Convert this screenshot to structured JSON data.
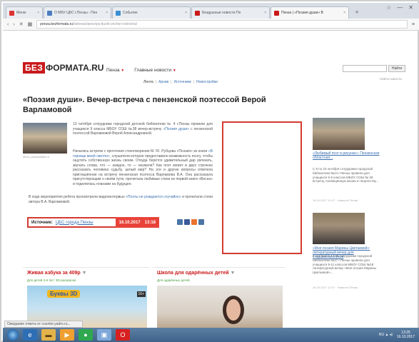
{
  "browser": {
    "tabs": [
      {
        "label": "Меню",
        "color": "#d33"
      },
      {
        "label": "О МБУ ЦБС г.Пензы - Пен",
        "color": "#4d7dbf"
      },
      {
        "label": "Событие",
        "color": "#3a8fd0"
      },
      {
        "label": "Бездушные новости Пе",
        "color": "#c9191b"
      },
      {
        "label": "Пенза | «Поэзия души» В",
        "color": "#c9191b",
        "active": true
      }
    ],
    "new_tab": "+",
    "url_host": "penza.bezformata.ru",
    "url_rest": "/listnews/poeziya-dushi-vecher-vstrecha/",
    "window_controls": [
      "☆",
      "—",
      "✕"
    ]
  },
  "site": {
    "logo_red": "БЕЗ",
    "logo_black": "ФОРМАТА.RU",
    "nav": [
      {
        "label": "Пенза",
        "arrow": "▼"
      },
      {
        "label": "Главные новости",
        "arrow": "▼"
      }
    ],
    "subnav": [
      {
        "label": "Лента"
      },
      {
        "label": "Архив"
      },
      {
        "label": "Источники"
      },
      {
        "label": "Новостройки"
      }
    ],
    "subnav_sep": "|",
    "search_button": "Найти",
    "search_hint": "Найти новости"
  },
  "article": {
    "title": "«Поэзия души». Вечер-встреча с пензенской поэтессой Верой Варламовой",
    "photo_caption": "Фото: penzacitylib.ru",
    "p1_text": "13 октября сотрудники городской детской библиотеки № 4 г.Пензы провели для учащихся 9 класса МБОУ СОШ №38 вечер-встречу ",
    "p1_link": "«Поэзия души»",
    "p1_tail": " с пензенской поэтессой Варламовой Верой Александровной.",
    "p2_text": "Начались встречи с прочтения стихотворения М. Ю. Рубцова «Поэзия» из книги ",
    "p2_link": "«В горнице моей светло»",
    "p2_tail": ", слушатели которое предоставило возможность поэту, чтобы ощутить собственную жизнь своим. Откуда берётся удивительный дар увлекать, звучать слова, что — каждое, то — неужели? Как поэт может в двух строчках рассказать человека судьбу, целый мир? На эти и другие вопросы ответила приглашённая на встречу пензенская поэтесса Варламова В.А. Она рассказала присутствующим о своём пути, прочитала любимые стихи из первой книги «Весна» и поделилась планами на будущее.",
    "p3_text": "В ходе мероприятия ребята просмотрели видеоинтервью ",
    "p3_link": "«Поэты не рождаются случайно»",
    "p3_tail": " и прочитали стихи автора В.А. Варламовой.",
    "source_label": "Источник:",
    "source_name": "ЦБС города Пензы",
    "source_date": "16.10.2017",
    "source_time": "13:18"
  },
  "share_colors": [
    "#4a76a8",
    "#3b5998",
    "#eb722e",
    "#4c75a3"
  ],
  "sidebar": {
    "items": [
      {
        "link": "«Любимый поэт в рисунке»: Пензенская областная...",
        "text": "С 9 по 23 октября сотрудники городской библиотеки №14 г.Пензы провели для учащихся 5-6 классов МБОУ СОШ № 38 встречу, посвящённую жизни и творчеству...",
        "meta": "16.10.2017 12:47 · Новости Пензы"
      },
      {
        "link": "«Моя поэзия Марины Цветаевой»: литературный вечер для старшеклассников",
        "text": "5 октября в 14.00 сотрудники городской библиотеки №17 г.Пензы провели для учащихся 9-11 классов МБОУ СОШ №18 литературный вечер «Моя поэзия Марины Цветаевой»...",
        "meta": "16.10.2017 12:47 · Новости Пензы"
      }
    ]
  },
  "widgets": [
    {
      "title": "Живая азбука за 409р",
      "chevron": "▼",
      "subtitle": "Для детей 3-6 лет: 3D-раскраски",
      "badge": "Буквы 3D",
      "age": "16+"
    },
    {
      "title": "Школа для одарённых детей",
      "chevron": "▼",
      "subtitle": "Для одарённых детей"
    }
  ],
  "status_tip": "Ожидание ответа от counter.yadro.ru...",
  "taskbar": {
    "clock_time": "13:25",
    "clock_date": "16.10.2017",
    "tray": "RU ▲ ◂)"
  }
}
